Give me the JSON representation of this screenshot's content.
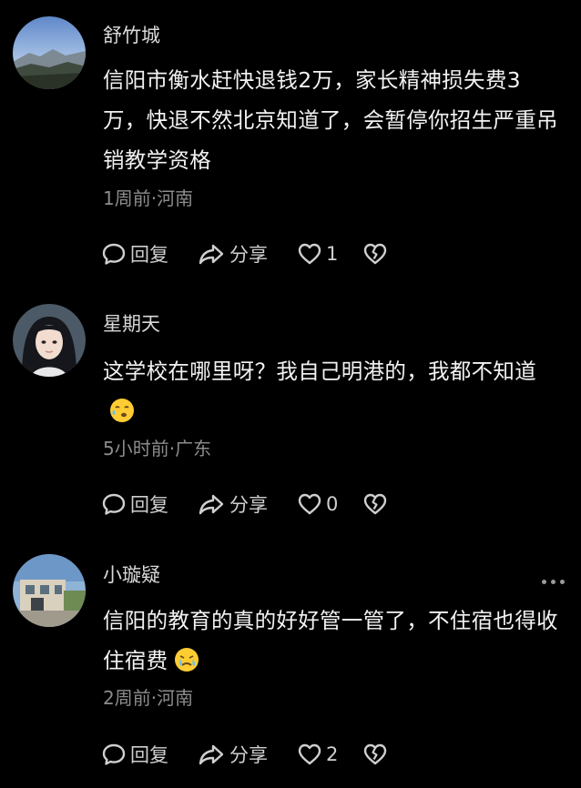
{
  "comments": [
    {
      "username": "舒竹城",
      "text": "信阳市衡水赶快退钱2万，家长精神损失费3万，快退不然北京知道了，会暂停你招生严重吊销教学资格",
      "meta": "1周前·河南",
      "reply_label": "回复",
      "share_label": "分享",
      "likes": "1"
    },
    {
      "username": "星期天",
      "text": "这学校在哪里呀？我自己明港的，我都不知道",
      "emoji": "face-with-tears-emoji",
      "meta": "5小时前·广东",
      "reply_label": "回复",
      "share_label": "分享",
      "likes": "0"
    },
    {
      "username": "小璇疑",
      "text": "信阳的教育的真的好好管一管了，不住宿也得收住宿费",
      "emoji": "crying-face-emoji",
      "meta": "2周前·河南",
      "reply_label": "回复",
      "share_label": "分享",
      "likes": "2"
    }
  ],
  "icons": {
    "reply": "speech-bubble-icon",
    "share": "share-arrow-icon",
    "like": "heart-icon",
    "dislike": "broken-heart-icon",
    "more": "more-dots-icon"
  },
  "colors": {
    "background": "#000000",
    "text": "#f2f2f2",
    "meta": "#8c8c8c",
    "action": "#cfcfcf"
  }
}
